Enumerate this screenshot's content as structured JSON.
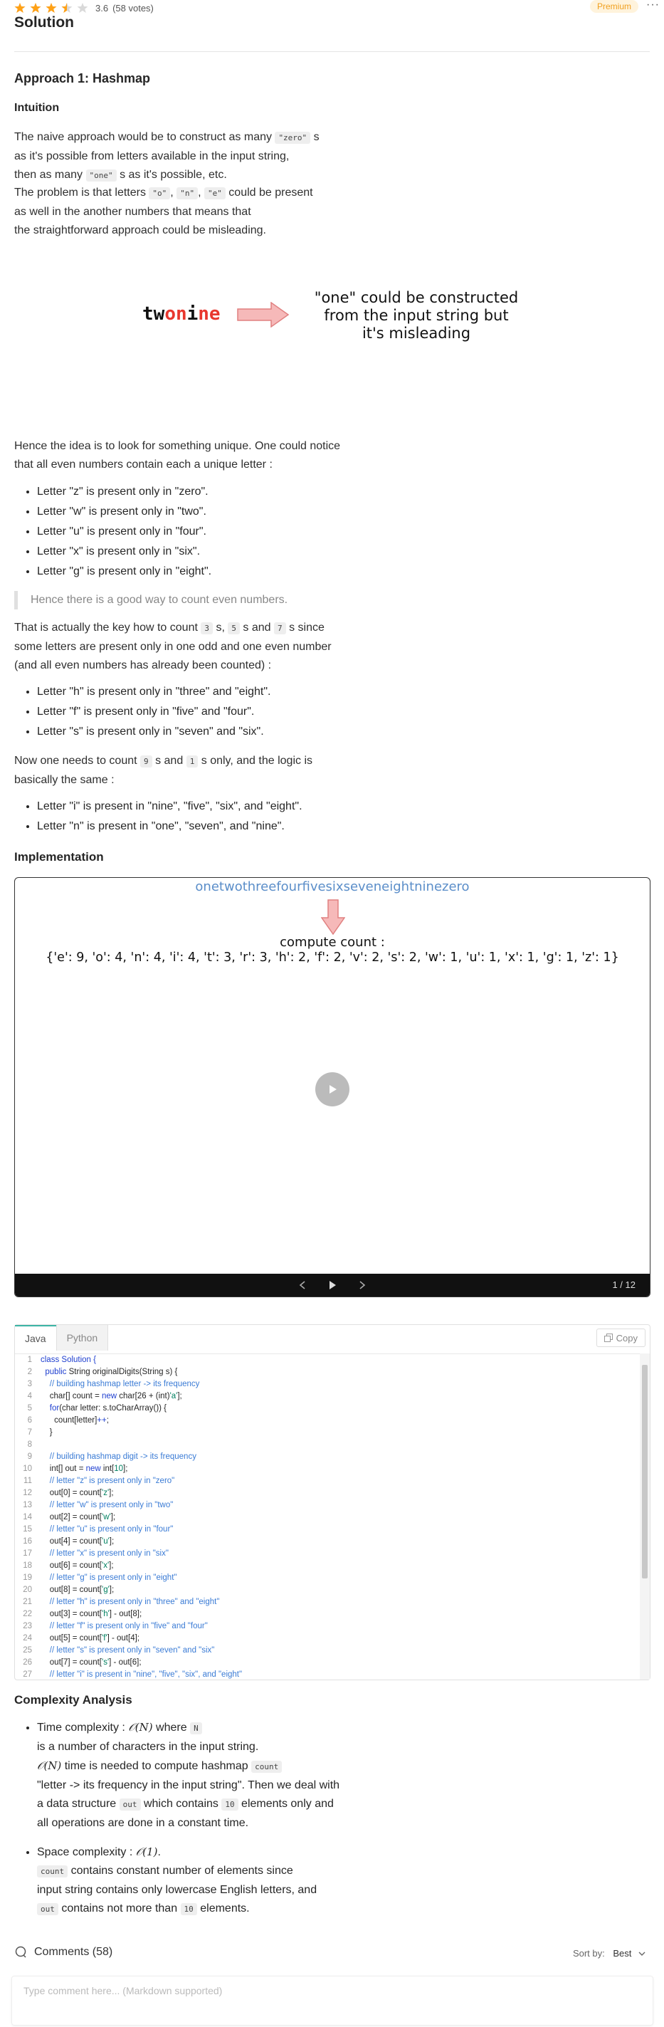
{
  "header": {
    "rating": "3.6",
    "votes": "(58 votes)",
    "premium_label": "Premium",
    "more": "···",
    "title": "Solution"
  },
  "approach": {
    "title": "Approach 1: Hashmap",
    "intuition": "Intuition",
    "p1": {
      "a": "The naive approach would be to construct as many",
      "code_zero": "\"zero\"",
      "b": " s",
      "c": "as it's possible from letters available in the input string,",
      "d": "then as many",
      "code_one": "\"one\"",
      "e": " s as it's possible, etc."
    },
    "p2": {
      "a": "The problem is that letters",
      "code_o": "\"o\"",
      "sep1": ",",
      "code_n": "\"n\"",
      "sep2": ",",
      "code_e": "\"e\"",
      "b": " could be present",
      "c": "as well in the another numbers that means that",
      "d": "the straightforward approach could be misleading."
    },
    "diagram1": {
      "word_parts": [
        "tw",
        "o",
        "n",
        "i",
        "ne"
      ],
      "text_lines": [
        "\"one\" could be constructed",
        "from the input string but",
        "it's misleading"
      ]
    },
    "p3": {
      "a": "Hence the idea is to look for something unique. One could notice",
      "b": "that all even numbers contain each a unique letter :"
    },
    "list_even": [
      "Letter \"z\" is present only in \"zero\".",
      "Letter \"w\" is present only in \"two\".",
      "Letter \"u\" is present only in \"four\".",
      "Letter \"x\" is present only in \"six\".",
      "Letter \"g\" is present only in \"eight\"."
    ],
    "quote": "Hence there is a good way to count even numbers.",
    "p4": {
      "a": "That is actually the key how to count",
      "code_3": "3",
      "b": " s,",
      "code_5": "5",
      "c": " s and",
      "code_7": "7",
      "d": " s since",
      "e": "some letters are present only in one odd and one even number",
      "f": "(and all even numbers has already been counted) :"
    },
    "list_odd": [
      "Letter \"h\" is present only in \"three\" and \"eight\".",
      "Letter \"f\" is present only in \"five\" and \"four\".",
      "Letter \"s\" is present only in \"seven\" and \"six\"."
    ],
    "p5": {
      "a": "Now one needs to count",
      "code_9": "9",
      "b": " s and",
      "code_1": "1",
      "c": " s only, and the logic is",
      "d": "basically the same :"
    },
    "list_last": [
      "Letter \"i\" is present in \"nine\", \"five\", \"six\", and \"eight\".",
      "Letter \"n\" is present in \"one\", \"seven\", and \"nine\"."
    ],
    "implementation": "Implementation"
  },
  "player": {
    "input": "onetwothreefourfivesixseveneightninezero",
    "label": "compute count :",
    "count": "{'e': 9, 'o': 4, 'n': 4, 'i': 4, 't': 3, 'r': 3, 'h': 2, 'f': 2, 'v': 2, 's': 2, 'w': 1, 'u': 1, 'x': 1, 'g': 1, 'z': 1}",
    "page": "1 / 12"
  },
  "code": {
    "tabs": [
      "Java",
      "Python"
    ],
    "copy": "Copy",
    "lines": [
      [
        [
          "kw",
          "class Solution {"
        ]
      ],
      [
        [
          "kw",
          "  public "
        ],
        [
          "pl",
          "String originalDigits(String s) {"
        ]
      ],
      [
        [
          "cm",
          "    // building hashmap letter -> its frequency"
        ]
      ],
      [
        [
          "pl",
          "    char[] count = "
        ],
        [
          "kw",
          "new "
        ],
        [
          "pl",
          "char[26 + (int)"
        ],
        [
          "st",
          "'a'"
        ],
        [
          "pl",
          "];"
        ]
      ],
      [
        [
          "kw",
          "    for"
        ],
        [
          "pl",
          "(char letter: s.toCharArray()) {"
        ]
      ],
      [
        [
          "pl",
          "      count[letter]"
        ],
        [
          "kw",
          "++"
        ],
        [
          "pl",
          ";"
        ]
      ],
      [
        [
          "pl",
          "    }"
        ]
      ],
      [
        [
          "pl",
          ""
        ]
      ],
      [
        [
          "cm",
          "    // building hashmap digit -> its frequency"
        ]
      ],
      [
        [
          "pl",
          "    int[] out = "
        ],
        [
          "kw",
          "new "
        ],
        [
          "pl",
          "int["
        ],
        [
          "st",
          "10"
        ],
        [
          "pl",
          "];"
        ]
      ],
      [
        [
          "cm",
          "    // letter \"z\" is present only in \"zero\""
        ]
      ],
      [
        [
          "pl",
          "    out[0] = count["
        ],
        [
          "st",
          "'z'"
        ],
        [
          "pl",
          "];"
        ]
      ],
      [
        [
          "cm",
          "    // letter \"w\" is present only in \"two\""
        ]
      ],
      [
        [
          "pl",
          "    out[2] = count["
        ],
        [
          "st",
          "'w'"
        ],
        [
          "pl",
          "];"
        ]
      ],
      [
        [
          "cm",
          "    // letter \"u\" is present only in \"four\""
        ]
      ],
      [
        [
          "pl",
          "    out[4] = count["
        ],
        [
          "st",
          "'u'"
        ],
        [
          "pl",
          "];"
        ]
      ],
      [
        [
          "cm",
          "    // letter \"x\" is present only in \"six\""
        ]
      ],
      [
        [
          "pl",
          "    out[6] = count["
        ],
        [
          "st",
          "'x'"
        ],
        [
          "pl",
          "];"
        ]
      ],
      [
        [
          "cm",
          "    // letter \"g\" is present only in \"eight\""
        ]
      ],
      [
        [
          "pl",
          "    out[8] = count["
        ],
        [
          "st",
          "'g'"
        ],
        [
          "pl",
          "];"
        ]
      ],
      [
        [
          "cm",
          "    // letter \"h\" is present only in \"three\" and \"eight\""
        ]
      ],
      [
        [
          "pl",
          "    out[3] = count["
        ],
        [
          "st",
          "'h'"
        ],
        [
          "pl",
          "] - out[8];"
        ]
      ],
      [
        [
          "cm",
          "    // letter \"f\" is present only in \"five\" and \"four\""
        ]
      ],
      [
        [
          "pl",
          "    out[5] = count["
        ],
        [
          "st",
          "'f'"
        ],
        [
          "pl",
          "] - out[4];"
        ]
      ],
      [
        [
          "cm",
          "    // letter \"s\" is present only in \"seven\" and \"six\""
        ]
      ],
      [
        [
          "pl",
          "    out[7] = count["
        ],
        [
          "st",
          "'s'"
        ],
        [
          "pl",
          "] - out[6];"
        ]
      ],
      [
        [
          "cm",
          "    // letter \"i\" is present in \"nine\", \"five\", \"six\", and \"eight\""
        ]
      ]
    ]
  },
  "complexity": {
    "title": "Complexity Analysis",
    "time": {
      "a": "Time complexity :",
      "math_n": "𝒪(N)",
      "b": " where",
      "code_N": "N",
      "c": "is a number of characters in the input string.",
      "math_n2": "𝒪(N)",
      "d": " time is needed to compute hashmap",
      "code_count": "count",
      "e": "\"letter -> its frequency in the input string\". Then we deal with",
      "f": "a data structure",
      "code_out": "out",
      "g": " which contains",
      "code_10": "10",
      "h": " elements only and",
      "i": "all operations are done in a constant time."
    },
    "space": {
      "a": "Space complexity :",
      "math_1": "𝒪(1)",
      "b": ".",
      "code_count": "count",
      "c": " contains constant number of elements since",
      "d": "input string contains only lowercase English letters, and",
      "code_out": "out",
      "e": " contains not more than",
      "code_10": "10",
      "f": " elements."
    }
  },
  "comments": {
    "title": "Comments (58)",
    "sort_label": "Sort by:",
    "sort_value": "Best",
    "placeholder": "Type comment here... (Markdown supported)"
  },
  "colors": {
    "star": "#ffa116",
    "accent_red": "#e8372e",
    "arrow_fill": "#f6b9b9",
    "arrow_stroke": "#e08080",
    "code_keyword": "#2040d0",
    "code_comment": "#3a7bd5",
    "code_string": "#008060"
  },
  "icons": {
    "stars": [
      "star-full-icon",
      "star-full-icon",
      "star-full-icon",
      "star-half-icon",
      "star-empty-icon"
    ],
    "comment": "comment-icon",
    "copy": "copy-icon",
    "play": "play-icon",
    "prev": "chevron-left-icon",
    "next": "chevron-right-icon"
  }
}
